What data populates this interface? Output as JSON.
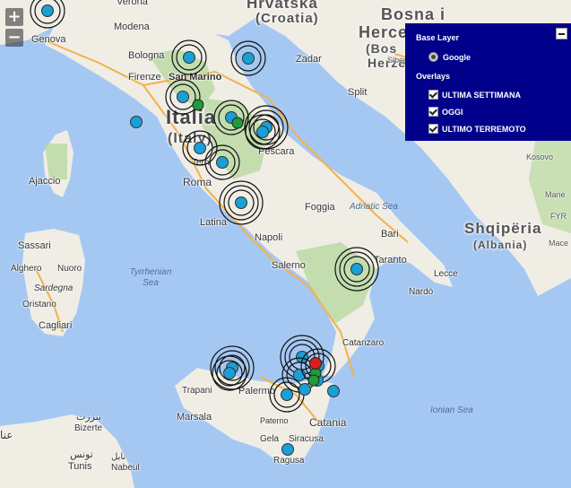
{
  "map": {
    "land_color": "#f0ede5",
    "sea_color": "#a5c8f3",
    "green_color": "#b8d8a0",
    "countries": [
      {
        "name": "Hrvatska",
        "sub": "(Croatia)"
      },
      {
        "name": "Bosna i",
        "sub": ""
      },
      {
        "name": "Italia",
        "sub": "(Italy)"
      },
      {
        "name": "Shqipëria",
        "sub": "(Albania)"
      }
    ],
    "country_extra": [
      "Herce",
      "(Bos",
      "Herze"
    ],
    "cities": [
      "Genova",
      "Verona",
      "Modena",
      "Bologna",
      "San Marino",
      "Firenze",
      "Zadar",
      "Split",
      "Pescara",
      "Ajaccio",
      "Roma",
      "Latina",
      "Foggia",
      "Napoli",
      "Salerno",
      "Bari",
      "Taranto",
      "Lecce",
      "Nardò",
      "Sassari",
      "Alghero",
      "Nuoro",
      "Sardegna",
      "Oristano",
      "Cagliari",
      "Terni",
      "Catanzaro",
      "Trapani",
      "Palermo",
      "Marsala",
      "Paterno",
      "Catania",
      "Gela",
      "Siracusa",
      "Ragusa",
      "Bizerte",
      "Tunis",
      "Nabeul",
      "Sibenik",
      "Kosovo",
      "Manė",
      "FYR",
      "Mace"
    ],
    "seas": [
      "Adriatic Sea",
      "Tyrrhenian Sea",
      "Ionian Sea"
    ],
    "script_labels": [
      "بنزرت",
      "عنا",
      "تونس",
      "نابل"
    ],
    "zoom_in": "+",
    "zoom_out": "−"
  },
  "quake_colors": {
    "week": "#1a9fd6",
    "today": "#1f9a3c",
    "latest": "#d81e1e"
  },
  "panel": {
    "base_layer_title": "Base Layer",
    "base_option": "Google",
    "overlays_title": "Overlays",
    "overlays": [
      "ULTIMA SETTIMANA",
      "OGGI",
      "ULTIMO TERREMOTO"
    ]
  }
}
